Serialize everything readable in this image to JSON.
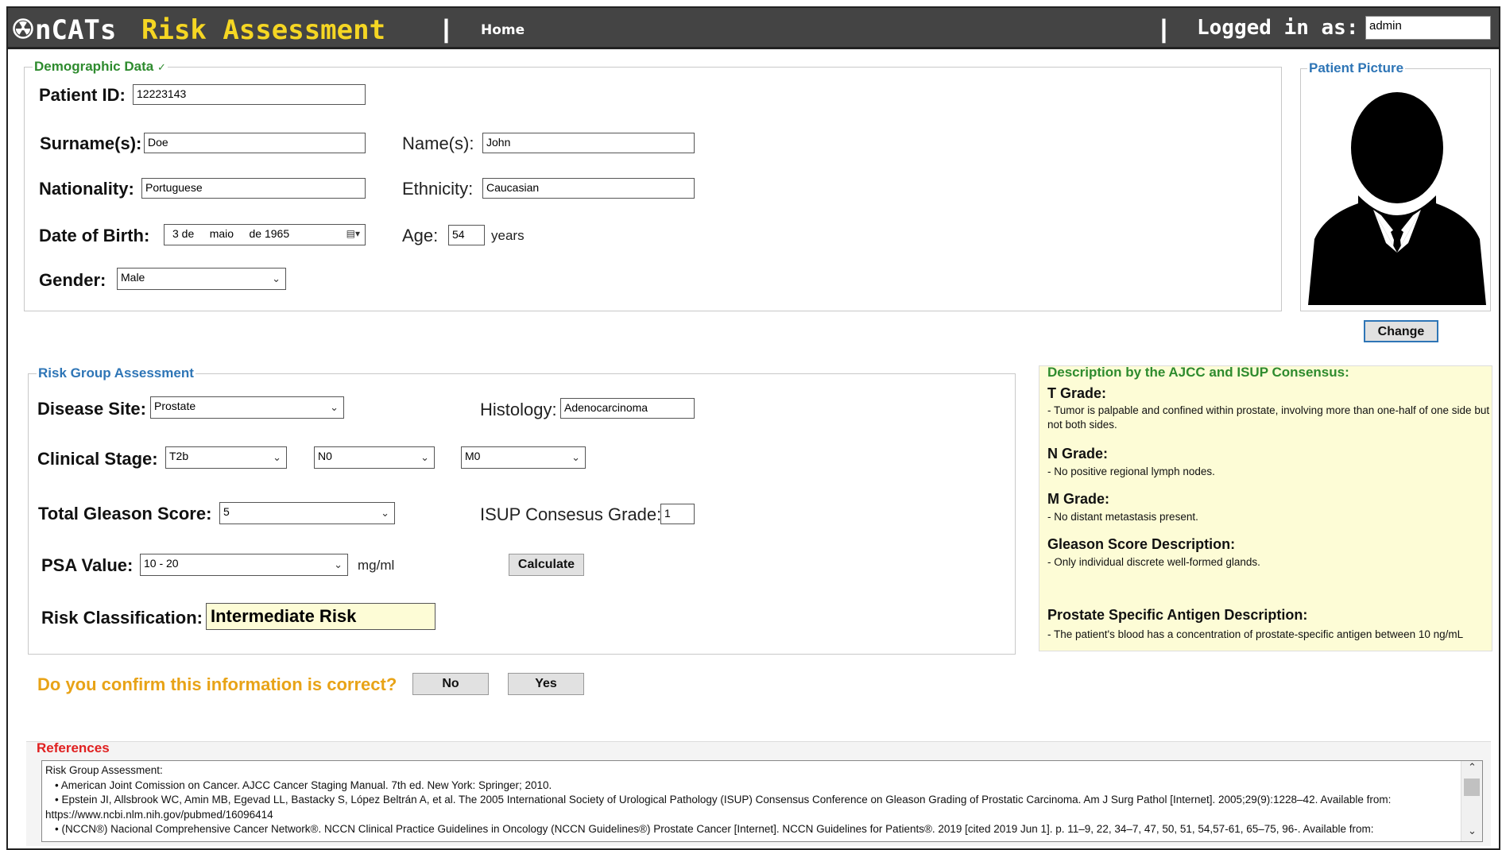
{
  "header": {
    "logo_text": "nCATs",
    "title": "Risk Assessment",
    "separator": "|",
    "home_link": "Home",
    "logged_in_label": "Logged in as:",
    "username": "admin"
  },
  "demographic": {
    "legend": "Demographic Data",
    "legend_check": "✓",
    "patient_id_label": "Patient ID:",
    "patient_id": "12223143",
    "surname_label": "Surname(s):",
    "surname": "Doe",
    "name_label": "Name(s):",
    "name": "John",
    "nationality_label": "Nationality:",
    "nationality": "Portuguese",
    "ethnicity_label": "Ethnicity:",
    "ethnicity": "Caucasian",
    "dob_label": "Date of Birth:",
    "dob_day": "3 de",
    "dob_month": "maio",
    "dob_year": "de 1965",
    "age_label": "Age:",
    "age": "54",
    "age_unit": "years",
    "gender_label": "Gender:",
    "gender": "Male"
  },
  "patient_picture": {
    "legend": "Patient Picture",
    "change_button": "Change"
  },
  "risk": {
    "legend": "Risk Group Assessment",
    "disease_site_label": "Disease Site:",
    "disease_site": "Prostate",
    "histology_label": "Histology:",
    "histology": "Adenocarcinoma",
    "clinical_stage_label": "Clinical Stage:",
    "stage_t": "T2b",
    "stage_n": "N0",
    "stage_m": "M0",
    "gleason_label": "Total Gleason Score:",
    "gleason": "5",
    "isup_label": "ISUP Consesus Grade:",
    "isup": "1",
    "psa_label": "PSA Value:",
    "psa": "10 - 20",
    "psa_unit": "mg/ml",
    "calculate_button": "Calculate",
    "classification_label": "Risk Classification:",
    "classification": "Intermediate Risk"
  },
  "description": {
    "legend": "Description by the AJCC and ISUP Consensus:",
    "t_title": "T Grade:",
    "t_text": "- Tumor is palpable and confined within prostate, involving more than one-half of one side but not both sides.",
    "n_title": "N Grade:",
    "n_text": "- No positive regional lymph nodes.",
    "m_title": "M Grade:",
    "m_text": "- No distant metastasis present.",
    "gleason_title": "Gleason Score Description:",
    "gleason_text": "- Only individual discrete well-formed glands.",
    "psa_title": "Prostate Specific Antigen Description:",
    "psa_text": "- The patient's blood has a concentration of prostate-specific antigen between 10 ng/mL"
  },
  "confirm": {
    "question": "Do you confirm this information is correct?",
    "no_button": "No",
    "yes_button": "Yes"
  },
  "references": {
    "legend": "References",
    "lines": [
      "Risk Group Assessment:",
      "  • American Joint Comission on Cancer. AJCC Cancer Staging Manual. 7th ed. New York: Springer; 2010.",
      "  • Epstein JI, Allsbrook WC, Amin MB, Egevad LL, Bastacky S, López Beltrán A, et al. The 2005 International Society of Urological Pathology (ISUP) Consensus Conference on Gleason Grading of Prostatic Carcinoma. Am J Surg Pathol [Internet]. 2005;29(9):1228–42. Available from:",
      "https://www.ncbi.nlm.nih.gov/pubmed/16096414",
      "  • (NCCN®) Nacional Comprehensive Cancer Network®. NCCN Clinical Practice Guidelines in Oncology (NCCN Guidelines®) Prostate Cancer [Internet]. NCCN Guidelines for Patients®. 2019 [cited 2019 Jun 1]. p. 11–9, 22, 34–7, 47, 50, 51, 54,57-61, 65–75, 96-. Available from:"
    ]
  },
  "colors": {
    "header_bg": "#444444",
    "title_yellow": "#f5d623",
    "demographic_green": "#2e8b2e",
    "blue_legend": "#2e75b6",
    "description_bg": "#fdfcd6",
    "confirm_orange": "#e8a317",
    "references_red": "#e02020",
    "classification_bg": "#fdfcd6"
  }
}
